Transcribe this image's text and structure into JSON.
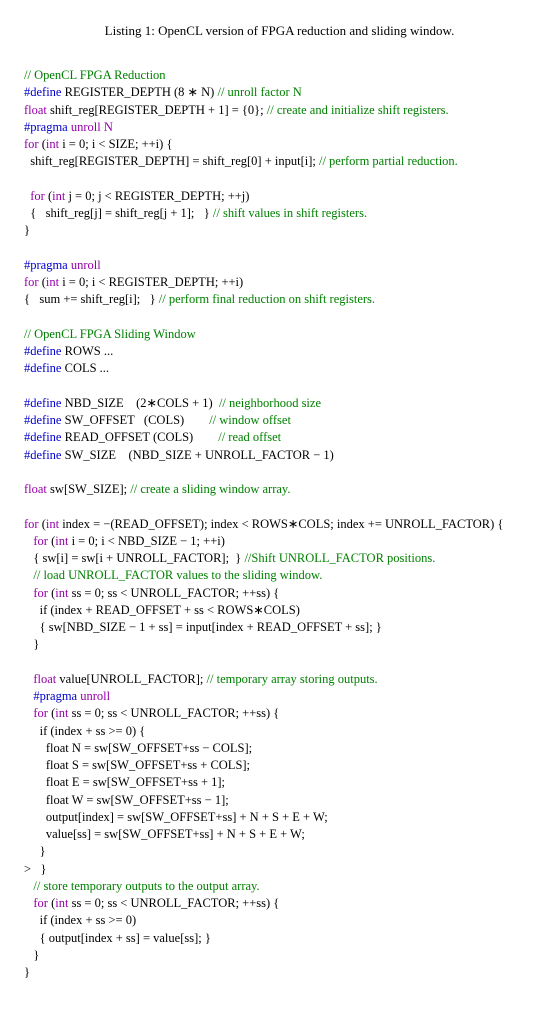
{
  "caption": "Listing 1: OpenCL version of FPGA reduction and sliding window.",
  "c_reduction_hdr": "// OpenCL FPGA Reduction",
  "kw_define": "#define",
  "reg_depth_name": "REGISTER_DEPTH (8 ",
  "ast": "∗",
  "reg_depth_tail": " N) ",
  "c_unroll_factor": "// unroll factor N",
  "ty_float": "float",
  "shift_decl": " shift_reg[REGISTER_DEPTH + 1] = {0}; ",
  "c_create_sr": "// create and initialize shift registers.",
  "kw_pragma": "#pragma",
  "pragma_unroll_n": " unroll N",
  "pragma_unroll": " unroll",
  "kw_for": "for",
  "ty_int": "int",
  "loop1_head": " i = 0; i < SIZE; ++i) {",
  "loop1_body": "  shift_reg[REGISTER_DEPTH] = shift_reg[0] + input[i]; ",
  "c_partial": "// perform partial reduction.",
  "loop2_head": " j = 0; j < REGISTER_DEPTH; ++j)",
  "loop2_body": "  {   shift_reg[j] = shift_reg[j + 1];   } ",
  "c_shiftvals": "// shift values in shift registers.",
  "loop3_head": " i = 0; i < REGISTER_DEPTH; ++i)",
  "loop3_body": "{   sum += shift_reg[i];   } ",
  "c_finalred": "// perform final reduction on shift registers.",
  "c_sliding_hdr": "// OpenCL FPGA Sliding Window",
  "def_rows": " ROWS ...",
  "def_cols": " COLS ...",
  "def_nbd": " NBD_SIZE    (2∗COLS + 1)  ",
  "c_nbd": "// neighborhood size",
  "def_swoff": " SW_OFFSET   (COLS)        ",
  "c_swoff": "// window offset",
  "def_readoff": " READ_OFFSET (COLS)        ",
  "c_readoff": "// read offset",
  "def_swsize": " SW_SIZE    (NBD_SIZE + UNROLL_FACTOR − 1)",
  "sw_decl": " sw[SW_SIZE]; ",
  "c_sw_decl": "// create a sliding window array.",
  "outer_head": " index = −(READ_OFFSET); index < ROWS∗COLS; index += UNROLL_FACTOR) {",
  "inner1_head": " i = 0; i < NBD_SIZE − 1; ++i)",
  "inner1_body": "   { sw[i] = sw[i + UNROLL_FACTOR];  } ",
  "c_shift_pos": "//Shift UNROLL_FACTOR positions.",
  "c_load": "   // load UNROLL_FACTOR values to the sliding window.",
  "inner2_head": " ss = 0; ss < UNROLL_FACTOR; ++ss) {",
  "inner2_if": "     if (index + READ_OFFSET + ss < ROWS∗COLS)",
  "inner2_body": "     { sw[NBD_SIZE − 1 + ss] = input[index + READ_OFFSET + ss]; }",
  "inner2_close": "   }",
  "val_decl": " value[UNROLL_FACTOR]; ",
  "c_val": "// temporary array storing outputs.",
  "inner3_head": " ss = 0; ss < UNROLL_FACTOR; ++ss) {",
  "inner3_if": "     if (index + ss >= 0) {",
  "lineN": "       float N = sw[SW_OFFSET+ss − COLS];",
  "lineS": "       float S = sw[SW_OFFSET+ss + COLS];",
  "lineE": "       float E = sw[SW_OFFSET+ss + 1];",
  "lineW": "       float W = sw[SW_OFFSET+ss − 1];",
  "lineOut": "       output[index] = sw[SW_OFFSET+ss] + N + S + E + W;",
  "lineVal": "       value[ss] = sw[SW_OFFSET+ss] + N + S + E + W;",
  "inner3_closeif": "     }",
  "inner3_closefor": "   }",
  "stray": ">",
  "c_store": "   // store temporary outputs to the output array.",
  "inner4_head": " ss = 0; ss < UNROLL_FACTOR; ++ss) {",
  "inner4_if": "     if (index + ss >= 0)",
  "inner4_body": "     { output[index + ss] = value[ss]; }",
  "inner4_close": "   }",
  "outer_close": "}"
}
